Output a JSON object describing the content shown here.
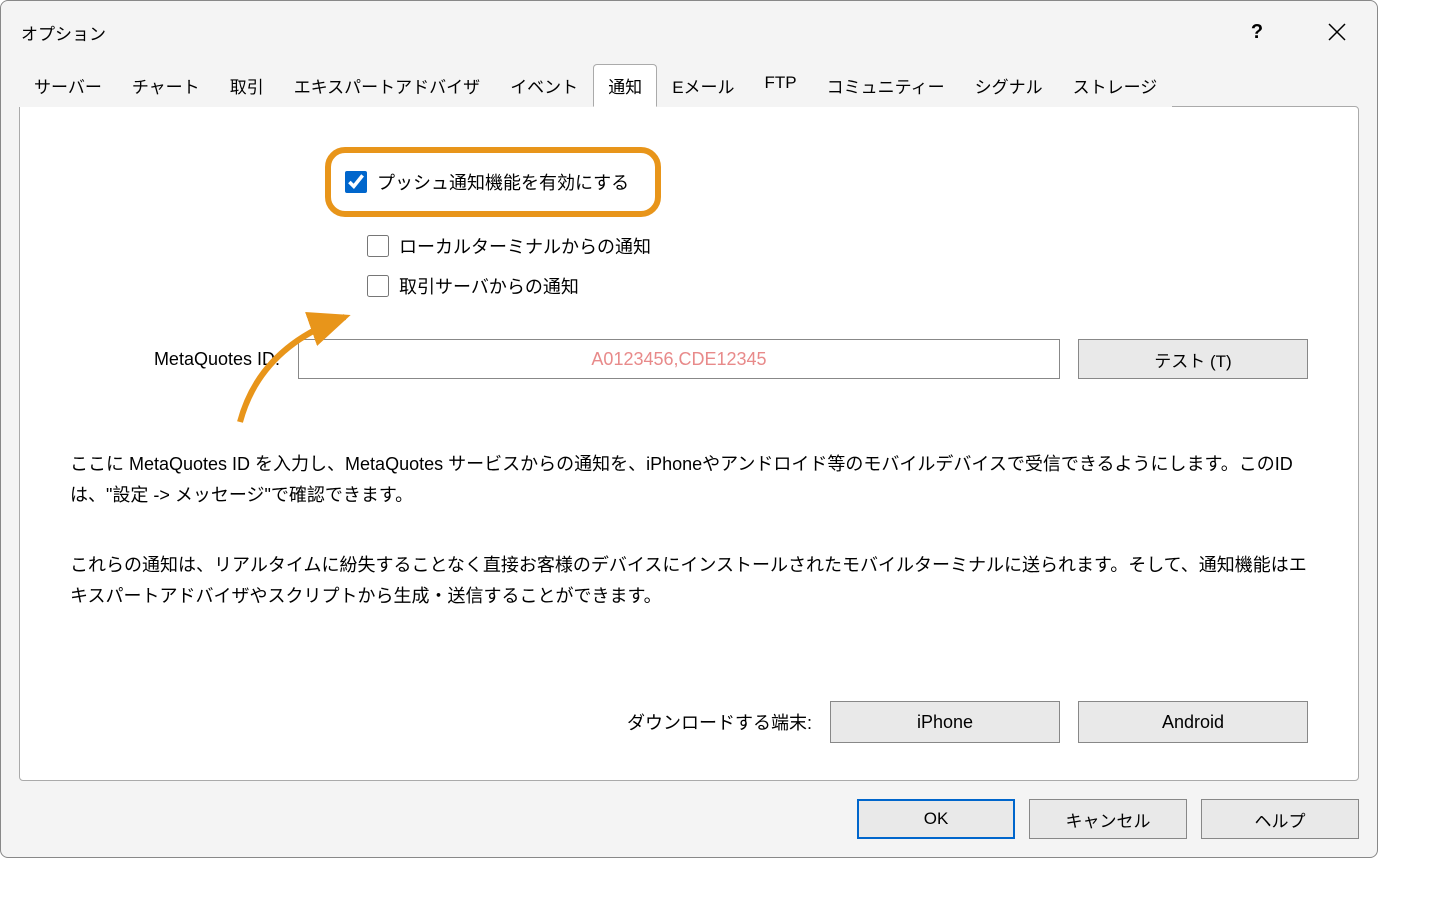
{
  "window": {
    "title": "オプション"
  },
  "tabs": [
    {
      "label": "サーバー"
    },
    {
      "label": "チャート"
    },
    {
      "label": "取引"
    },
    {
      "label": "エキスパートアドバイザ"
    },
    {
      "label": "イベント"
    },
    {
      "label": "通知"
    },
    {
      "label": "Eメール"
    },
    {
      "label": "FTP"
    },
    {
      "label": "コミュニティー"
    },
    {
      "label": "シグナル"
    },
    {
      "label": "ストレージ"
    }
  ],
  "active_tab_index": 5,
  "checkboxes": {
    "enable_push": {
      "label": "プッシュ通知機能を有効にする",
      "checked": true
    },
    "local_terminal": {
      "label": "ローカルターミナルからの通知",
      "checked": false
    },
    "trade_server": {
      "label": "取引サーバからの通知",
      "checked": false
    }
  },
  "metaquotes": {
    "label": "MetaQuotes ID:",
    "value": "A0123456,CDE12345",
    "test_button": "テスト (T)"
  },
  "description": {
    "para1": "ここに MetaQuotes ID を入力し、MetaQuotes サービスからの通知を、iPhoneやアンドロイド等のモバイルデバイスで受信できるようにします。このIDは、\"設定 -> メッセージ\"で確認できます。",
    "para2": "これらの通知は、リアルタイムに紛失することなく直接お客様のデバイスにインストールされたモバイルターミナルに送られます。そして、通知機能はエキスパートアドバイザやスクリプトから生成・送信することができます。"
  },
  "download": {
    "label": "ダウンロードする端末:",
    "iphone_button": "iPhone",
    "android_button": "Android"
  },
  "footer": {
    "ok": "OK",
    "cancel": "キャンセル",
    "help": "ヘルプ"
  }
}
